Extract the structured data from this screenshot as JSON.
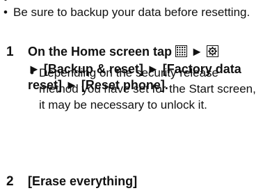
{
  "note": {
    "bullet": "•",
    "text": "Be sure to backup your data before resetting."
  },
  "step1": {
    "number": "1",
    "prefix": "On the Home screen tap",
    "arrow1": "►",
    "arrow2": "►",
    "path": "[Backup & reset] ► [Factory data reset] ► [Reset phone].",
    "icons": [
      "apps-grid-icon",
      "settings-icon"
    ],
    "sub_note": {
      "bullet": "•",
      "text": "Depending on the security release method you have set for the Start screen, it may be necessary to unlock it."
    }
  },
  "step2": {
    "number": "2",
    "instruction": "[Erase everything]"
  }
}
